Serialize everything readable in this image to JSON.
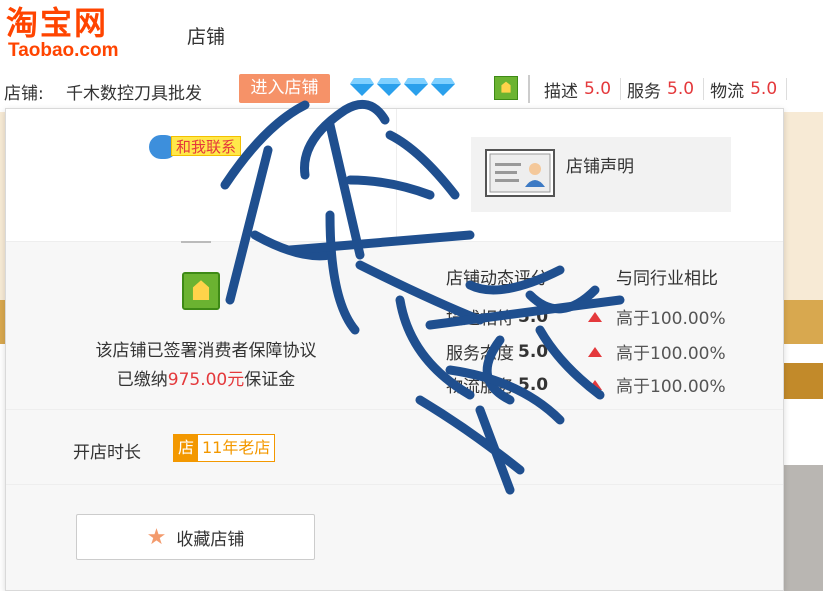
{
  "logo": {
    "cn": "淘宝网",
    "en": "Taobao.com"
  },
  "header": {
    "title": "店铺"
  },
  "shopbar": {
    "label": "店铺:",
    "shop_name": "千木数控刀具批发",
    "enter_label": "进入店铺",
    "ratings": [
      {
        "label": "描述",
        "value": "5.0"
      },
      {
        "label": "服务",
        "value": "5.0"
      },
      {
        "label": "物流",
        "value": "5.0"
      }
    ]
  },
  "panel": {
    "contact_label": "和我联系",
    "declaration_label": "店铺声明",
    "guarantee_line1": "该店铺已签署消费者保障协议",
    "guarantee_line2_pre": "已缴纳",
    "guarantee_amount": "975.00元",
    "guarantee_line2_post": "保证金",
    "dynamic_header": "店铺动态评分",
    "compare_header": "与同行业相比",
    "scores": [
      {
        "label": "描述相符",
        "value": "5.0",
        "compare": "高于100.00%"
      },
      {
        "label": "服务态度",
        "value": "5.0",
        "compare": "高于100.00%"
      },
      {
        "label": "物流服务",
        "value": "5.0",
        "compare": "高于100.00%"
      }
    ],
    "open_label": "开店时长",
    "age_icon": "店",
    "age_text": "11年老店",
    "fav_label": "收藏店铺"
  },
  "watermark": "假货",
  "colors": {
    "brand": "#ff4400",
    "accent": "#e4393c",
    "watermark": "#1f4f8f"
  }
}
